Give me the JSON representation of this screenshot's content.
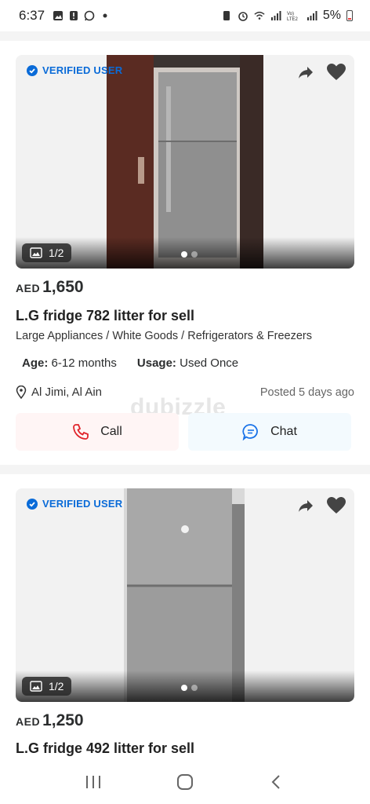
{
  "status_bar": {
    "time": "6:37",
    "battery": "5%",
    "volte_label": "Vo))\nLTE2"
  },
  "listings": [
    {
      "verified_label": "VERIFIED USER",
      "photo_counter": "1/2",
      "currency": "AED",
      "price": "1,650",
      "title": "L.G fridge 782 litter for sell",
      "category": "Large Appliances / White Goods / Refrigerators & Freezers",
      "age_label": "Age:",
      "age_value": "6-12 months",
      "usage_label": "Usage:",
      "usage_value": "Used Once",
      "location": "Al Jimi, Al Ain",
      "posted": "Posted 5 days ago",
      "call_label": "Call",
      "chat_label": "Chat",
      "watermark": "dubizzle"
    },
    {
      "verified_label": "VERIFIED USER",
      "photo_counter": "1/2",
      "currency": "AED",
      "price": "1,250",
      "title": "L.G fridge 492 litter for sell"
    }
  ],
  "colors": {
    "verified_blue": "#0a6bd8",
    "call_red": "#e0242b",
    "chat_blue": "#1a73e8"
  }
}
